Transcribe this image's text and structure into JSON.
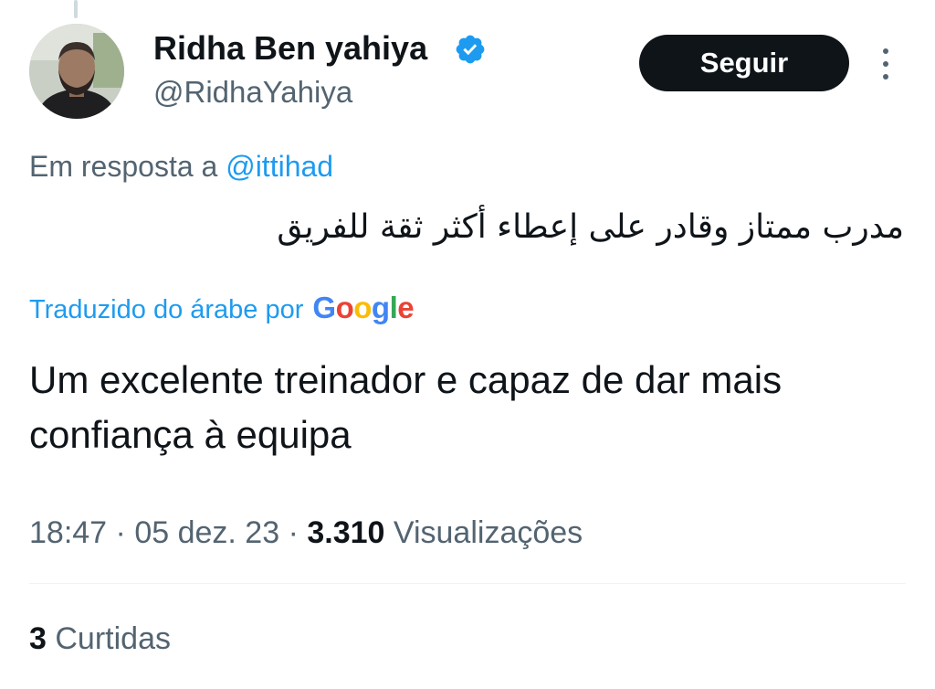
{
  "author": {
    "name": "Ridha Ben yahiya",
    "handle": "@RidhaYahiya",
    "verified_icon": "verified-badge-icon",
    "avatar_icon": "avatar-photo"
  },
  "actions": {
    "follow_label": "Seguir",
    "more_icon": "more-options-icon"
  },
  "reply": {
    "prefix": "Em resposta a",
    "mention": "@ittihad"
  },
  "tweet": {
    "original_text": "مدرب ممتاز وقادر على إعطاء أكثر ثقة للفريق",
    "translation_label": "Traduzido do árabe por",
    "translation_provider": "Google",
    "translated_text": "Um excelente treinador e capaz de dar mais confiança à equipa"
  },
  "meta": {
    "time": "18:47",
    "separator": "·",
    "date": "05 dez. 23",
    "views_count": "3.310",
    "views_label": "Visualizações"
  },
  "engagement": {
    "likes_count": "3",
    "likes_label": "Curtidas"
  },
  "colors": {
    "text_primary": "#0f1419",
    "text_secondary": "#536471",
    "accent": "#1d9bf0",
    "button_bg": "#0f1419"
  }
}
